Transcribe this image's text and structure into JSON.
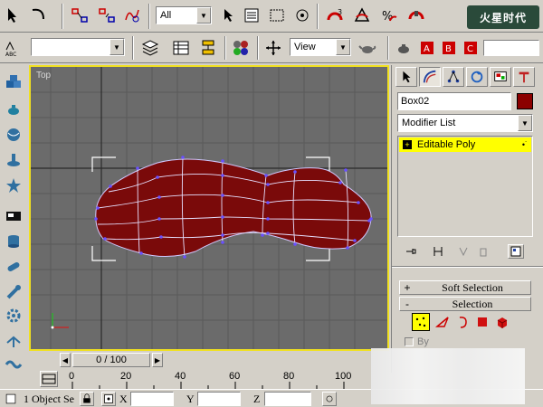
{
  "toolbar": {
    "selection_filter": "All",
    "named_selection": "",
    "reference_coord": "View",
    "watermark": "火星时代"
  },
  "viewport": {
    "label": "Top"
  },
  "command_panel": {
    "object_name": "Box02",
    "object_color": "#8b0000",
    "modifier_list": "Modifier List",
    "stack_items": [
      {
        "label": "Editable Poly"
      }
    ],
    "rollouts": {
      "soft_selection": "Soft Selection",
      "selection": "Selection"
    },
    "soft_selection_sign": "+",
    "selection_sign": "-",
    "by_vertex": "By"
  },
  "timeline": {
    "slider": "0 / 100",
    "ticks": [
      "0",
      "20",
      "40",
      "60",
      "80",
      "100"
    ]
  },
  "status": {
    "selected": "1 Object Se",
    "x_label": "X",
    "y_label": "Y",
    "z_label": "Z"
  },
  "colors": {
    "mesh_fill": "#7a0a0a",
    "viewport_border": "#f0e020",
    "stack_highlight": "#ffff00"
  }
}
